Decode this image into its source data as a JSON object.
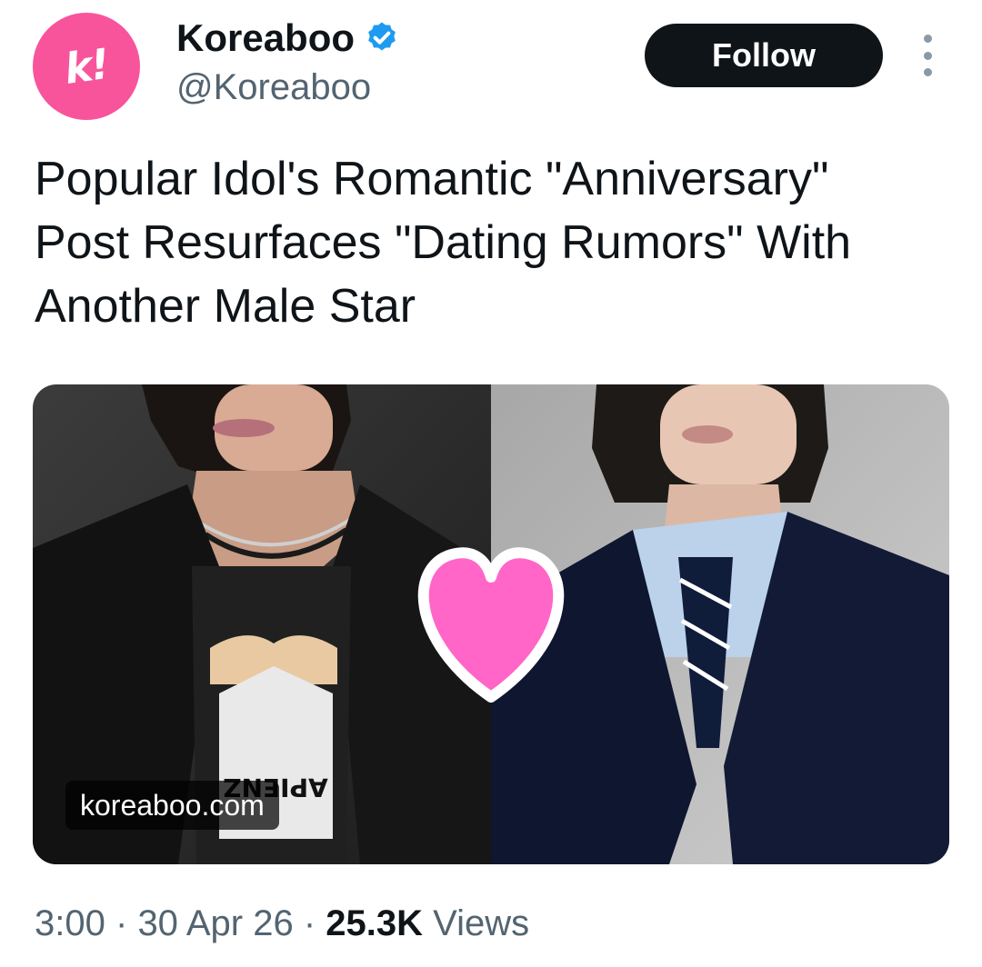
{
  "colors": {
    "avatar_bg": "#f8549c",
    "verified_blue": "#1d9bf0",
    "follow_bg": "#0f1419",
    "secondary_text": "#536471",
    "heart_fill": "#ff66c7"
  },
  "account": {
    "name": "Koreaboo",
    "handle": "@Koreaboo",
    "avatar_text": "k!",
    "verified": true
  },
  "follow_label": "Follow",
  "tweet": {
    "lines": [
      "Popular Idol's Romantic \"Anniversary\"",
      "Post Resurfaces \"Dating Rumors\" With",
      "Another Male Star"
    ]
  },
  "media": {
    "link_label": "koreaboo.com",
    "shirt_text": "APIENZ"
  },
  "meta": {
    "time": "3:00",
    "separator": "·",
    "date": "30 Apr 26",
    "views_count": "25.3K",
    "views_label": "Views"
  },
  "icons": [
    "verified-badge-icon",
    "more-options-icon",
    "heart-icon"
  ]
}
